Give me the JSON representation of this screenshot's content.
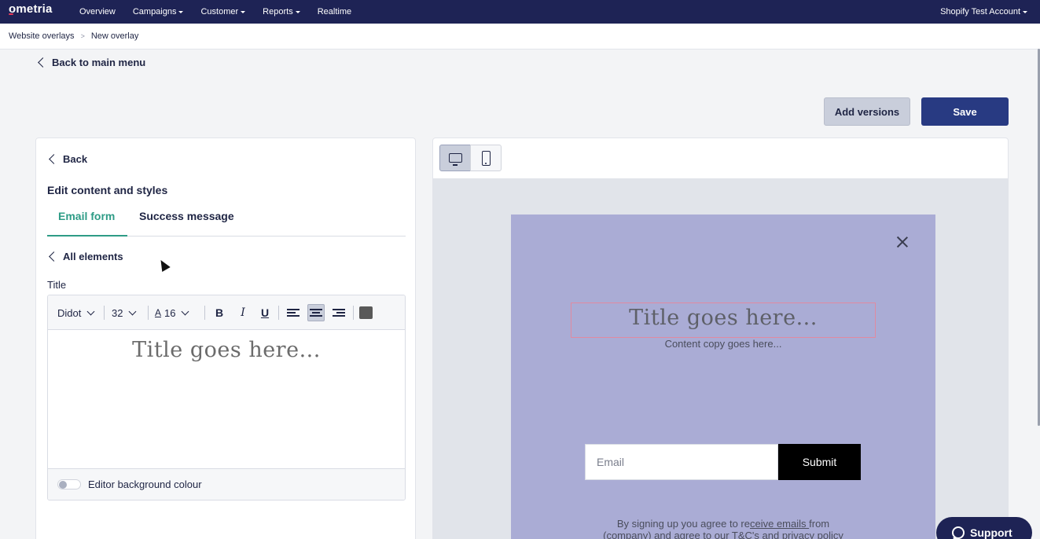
{
  "app": {
    "logo": "ometria"
  },
  "nav": {
    "items": [
      {
        "label": "Overview",
        "dropdown": false
      },
      {
        "label": "Campaigns",
        "dropdown": true
      },
      {
        "label": "Customer",
        "dropdown": true
      },
      {
        "label": "Reports",
        "dropdown": true
      },
      {
        "label": "Realtime",
        "dropdown": false
      }
    ],
    "account": "Shopify Test Account"
  },
  "breadcrumb": {
    "parent": "Website overlays",
    "separator": ">",
    "current": "New overlay"
  },
  "back_main": "Back to main menu",
  "actions": {
    "add_versions": "Add versions",
    "save": "Save"
  },
  "editor_panel": {
    "back": "Back",
    "heading": "Edit content and styles",
    "tabs": [
      {
        "label": "Email form",
        "active": true
      },
      {
        "label": "Success message",
        "active": false
      }
    ],
    "all_elements": "All elements",
    "field_label": "Title",
    "toolbar": {
      "font": "Didot",
      "size": "32",
      "line_height_icon": "A",
      "line_height": "16",
      "bold": "B",
      "italic": "I",
      "underline": "U",
      "text_color": "#595959",
      "alignment": "center"
    },
    "content": "Title goes here...",
    "bg_toggle_label": "Editor background colour",
    "bg_toggle_on": false
  },
  "preview": {
    "device": "desktop",
    "overlay_bg": "#aaacd5",
    "title": "Title goes here...",
    "copy": "Content copy goes here...",
    "email_placeholder": "Email",
    "submit": "Submit",
    "legal_1a": "By signing up you agree to re",
    "legal_1b": "ceive emails ",
    "legal_1c": "from",
    "legal_2": "(company) and agree to our T&C's and privacy policy"
  },
  "support": "Support",
  "colors": {
    "nav_bg": "#1e2355",
    "accent": "#2e9c86",
    "primary_button": "#283a82"
  }
}
